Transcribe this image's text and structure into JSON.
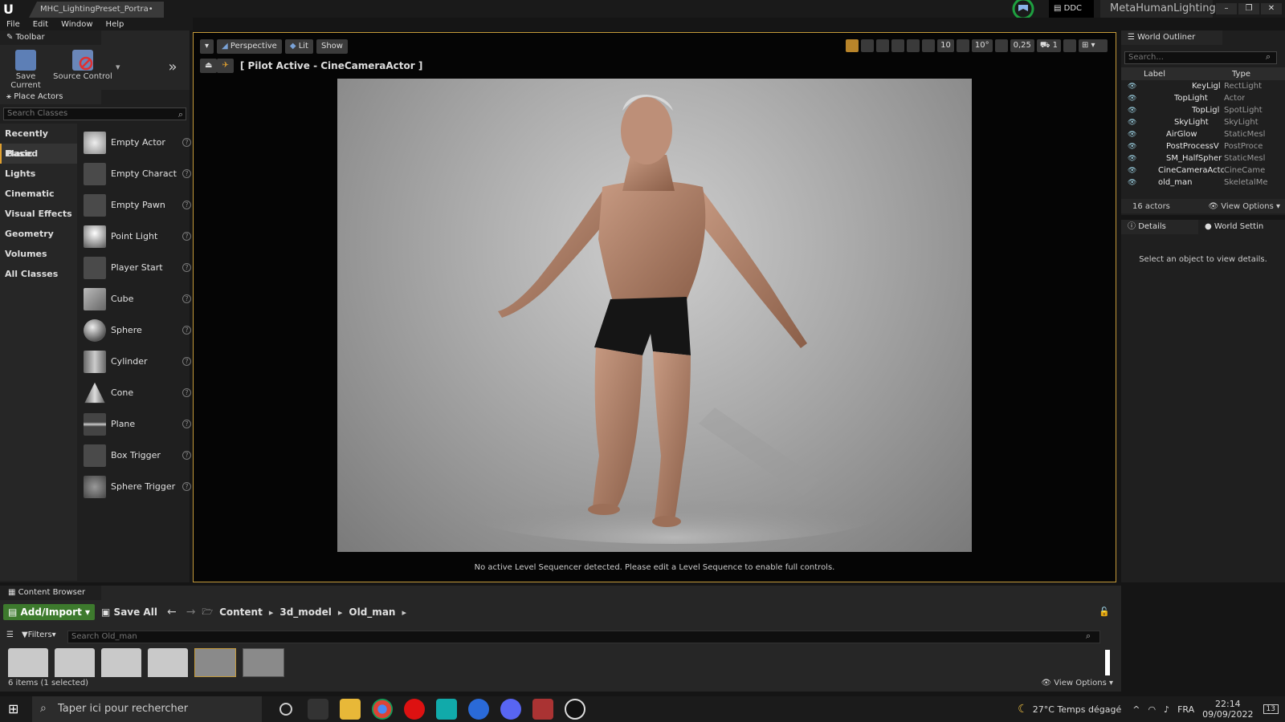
{
  "titlebar": {
    "doc_tab": "MHC_LightingPreset_Portra•",
    "ddc": "DDC",
    "app_name": "MetaHumanLighting",
    "win_min": "–",
    "win_max": "❐",
    "win_close": "✕"
  },
  "menu": [
    "File",
    "Edit",
    "Window",
    "Help"
  ],
  "toolbar": {
    "tab": "Toolbar",
    "save_current": "Save Current",
    "source_control": "Source Control"
  },
  "place_actors": {
    "tab": "Place Actors",
    "search_placeholder": "Search Classes",
    "categories": [
      "Recently Placed",
      "Basic",
      "Lights",
      "Cinematic",
      "Visual Effects",
      "Geometry",
      "Volumes",
      "All Classes"
    ],
    "items": [
      "Empty Actor",
      "Empty Charact",
      "Empty Pawn",
      "Point Light",
      "Player Start",
      "Cube",
      "Sphere",
      "Cylinder",
      "Cone",
      "Plane",
      "Box Trigger",
      "Sphere Trigger"
    ]
  },
  "viewport": {
    "perspective": "Perspective",
    "lit": "Lit",
    "show": "Show",
    "pilot": "[ Pilot Active - CineCameraActor ]",
    "grid_snap": "10",
    "rot_snap": "10°",
    "scale_snap": "0,25",
    "cam_speed": "1",
    "sequencer_msg": "No active Level Sequencer detected. Please edit a Level Sequence to enable full controls."
  },
  "outliner": {
    "tab": "World Outliner",
    "search_placeholder": "Search...",
    "col_label": "Label",
    "col_type": "Type",
    "rows": [
      {
        "label": "KeyLigl",
        "type": "RectLight",
        "indent": 3
      },
      {
        "label": "TopLight",
        "type": "Actor",
        "indent": 2
      },
      {
        "label": "TopLigl",
        "type": "SpotLight",
        "indent": 3
      },
      {
        "label": "SkyLight",
        "type": "SkyLight",
        "indent": 2
      },
      {
        "label": "AirGlow",
        "type": "StaticMesl",
        "indent": 1
      },
      {
        "label": "PostProcessV",
        "type": "PostProce",
        "indent": 1
      },
      {
        "label": "SM_HalfSpher",
        "type": "StaticMesl",
        "indent": 1
      },
      {
        "label": "CineCameraActc",
        "type": "CineCame",
        "indent": 0
      },
      {
        "label": "old_man",
        "type": "SkeletalMe",
        "indent": 0
      }
    ],
    "actor_count": "16 actors",
    "view_options": "View Options"
  },
  "details": {
    "tab": "Details",
    "world_settings": "World Settin",
    "empty_msg": "Select an object to view details."
  },
  "content_browser": {
    "tab": "Content Browser",
    "add_import": "Add/Import",
    "save_all": "Save All",
    "path": [
      "Content",
      "3d_model",
      "Old_man"
    ],
    "filters": "Filters",
    "search_placeholder": "Search Old_man",
    "items_status": "6 items (1 selected)",
    "view_options": "View Options"
  },
  "taskbar": {
    "search": "Taper ici pour rechercher",
    "weather": "27°C  Temps dégagé",
    "lang": "FRA",
    "time": "22:14",
    "date": "09/09/2022",
    "notif": "13"
  },
  "colors": {
    "accent": "#c49a3a",
    "add_green": "#3d7a2d"
  }
}
